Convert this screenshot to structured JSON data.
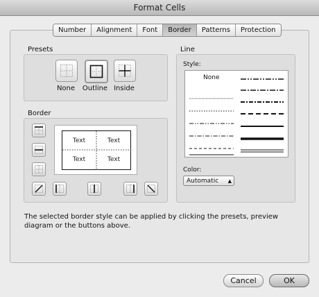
{
  "window": {
    "title": "Format Cells"
  },
  "tabs": [
    {
      "label": "Number",
      "active": false
    },
    {
      "label": "Alignment",
      "active": false
    },
    {
      "label": "Font",
      "active": false
    },
    {
      "label": "Border",
      "active": true
    },
    {
      "label": "Patterns",
      "active": false
    },
    {
      "label": "Protection",
      "active": false
    }
  ],
  "presets": {
    "label": "Presets",
    "items": [
      {
        "label": "None",
        "icon": "border-none-icon"
      },
      {
        "label": "Outline",
        "icon": "border-outline-icon"
      },
      {
        "label": "Inside",
        "icon": "border-inside-icon"
      }
    ]
  },
  "border": {
    "label": "Border",
    "preview_cells": [
      "Text",
      "Text",
      "Text",
      "Text"
    ]
  },
  "line": {
    "label": "Line",
    "style_label": "Style:",
    "none_label": "None",
    "color_label": "Color:",
    "color_value": "Automatic"
  },
  "hint": "The selected border style can be applied by clicking the presets, preview diagram or the buttons above.",
  "buttons": {
    "cancel": "Cancel",
    "ok": "OK"
  }
}
